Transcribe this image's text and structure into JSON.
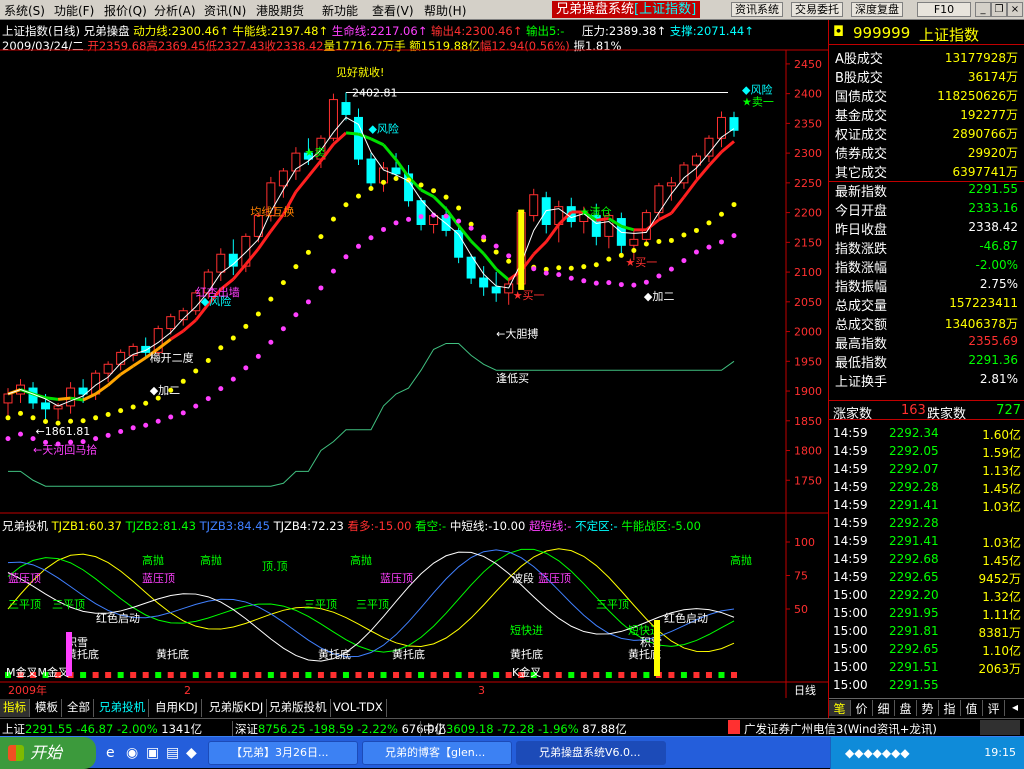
{
  "menu": {
    "items": [
      "系统(S)",
      "功能(F)",
      "报价(Q)",
      "分析(A)",
      "资讯(N)",
      "港股期货",
      "新功能",
      "查看(V)",
      "帮助(H)"
    ],
    "title": "兄弟操盘系统",
    "title_sub": "[上证指数]",
    "buttons": [
      "资讯系统",
      "交易委托",
      "深度复盘"
    ],
    "fkey": "F10"
  },
  "chart_header": {
    "line1": {
      "name": "上证指数(日线)",
      "tool": "兄弟操盘",
      "dl": "动力线:2300.46↑",
      "nn": "牛能线:2197.48↑",
      "sm": "生命线:2217.06↑",
      "sc": "输出4:2300.46↑",
      "sc5": "输出5:-",
      "yl": "压力:2389.38↑",
      "zc": "支撑:2071.44↑"
    },
    "line2": {
      "date": "2009/03/24/二",
      "open": "开2359.68",
      "high": "高2369.45",
      "low": "低2327.43",
      "close": "收2338.42",
      "vol": "量17716.7万手",
      "amt": "额1519.88亿",
      "chg": "幅12.94(0.56%)",
      "amp": "振1.81%"
    }
  },
  "chart_data": [
    {
      "type": "candlestick",
      "title": "上证指数(日线)",
      "ylim": [
        1700,
        2470
      ],
      "yticks": [
        2450,
        2400,
        2350,
        2300,
        2250,
        2200,
        2150,
        2100,
        2050,
        2000,
        1950,
        1900,
        1850,
        1800,
        1750
      ],
      "ohlc": [
        [
          1880,
          1905,
          1858,
          1895
        ],
        [
          1895,
          1920,
          1880,
          1910
        ],
        [
          1905,
          1915,
          1870,
          1880
        ],
        [
          1880,
          1895,
          1850,
          1870
        ],
        [
          1870,
          1880,
          1852,
          1875
        ],
        [
          1875,
          1915,
          1862,
          1905
        ],
        [
          1905,
          1920,
          1880,
          1895
        ],
        [
          1895,
          1935,
          1885,
          1930
        ],
        [
          1930,
          1950,
          1915,
          1945
        ],
        [
          1945,
          1970,
          1935,
          1965
        ],
        [
          1960,
          1980,
          1950,
          1975
        ],
        [
          1975,
          1990,
          1955,
          1965
        ],
        [
          1965,
          2010,
          1960,
          2005
        ],
        [
          2005,
          2030,
          1995,
          2025
        ],
        [
          2020,
          2040,
          2010,
          2035
        ],
        [
          2035,
          2070,
          2028,
          2065
        ],
        [
          2065,
          2105,
          2055,
          2100
        ],
        [
          2100,
          2140,
          2085,
          2130
        ],
        [
          2130,
          2155,
          2095,
          2110
        ],
        [
          2110,
          2165,
          2100,
          2160
        ],
        [
          2160,
          2200,
          2150,
          2195
        ],
        [
          2195,
          2260,
          2185,
          2250
        ],
        [
          2245,
          2275,
          2225,
          2270
        ],
        [
          2270,
          2310,
          2255,
          2300
        ],
        [
          2300,
          2325,
          2280,
          2290
        ],
        [
          2290,
          2330,
          2275,
          2325
        ],
        [
          2325,
          2400,
          2320,
          2390
        ],
        [
          2385,
          2402,
          2355,
          2365
        ],
        [
          2360,
          2375,
          2280,
          2290
        ],
        [
          2290,
          2300,
          2240,
          2250
        ],
        [
          2250,
          2285,
          2235,
          2275
        ],
        [
          2275,
          2300,
          2255,
          2265
        ],
        [
          2265,
          2280,
          2210,
          2220
        ],
        [
          2220,
          2225,
          2170,
          2180
        ],
        [
          2180,
          2200,
          2165,
          2195
        ],
        [
          2195,
          2210,
          2160,
          2170
        ],
        [
          2170,
          2175,
          2115,
          2125
        ],
        [
          2125,
          2130,
          2080,
          2090
        ],
        [
          2090,
          2110,
          2060,
          2075
        ],
        [
          2075,
          2100,
          2050,
          2065
        ],
        [
          2065,
          2090,
          2045,
          2080
        ],
        [
          2080,
          2200,
          2075,
          2200
        ],
        [
          2195,
          2240,
          2185,
          2230
        ],
        [
          2225,
          2235,
          2165,
          2180
        ],
        [
          2180,
          2220,
          2150,
          2210
        ],
        [
          2210,
          2225,
          2175,
          2185
        ],
        [
          2185,
          2210,
          2165,
          2200
        ],
        [
          2195,
          2215,
          2145,
          2160
        ],
        [
          2160,
          2200,
          2140,
          2195
        ],
        [
          2190,
          2200,
          2130,
          2145
        ],
        [
          2145,
          2170,
          2120,
          2155
        ],
        [
          2155,
          2205,
          2150,
          2200
        ],
        [
          2200,
          2250,
          2190,
          2245
        ],
        [
          2245,
          2260,
          2220,
          2250
        ],
        [
          2250,
          2285,
          2240,
          2280
        ],
        [
          2280,
          2300,
          2255,
          2295
        ],
        [
          2295,
          2330,
          2285,
          2325
        ],
        [
          2325,
          2370,
          2310,
          2360
        ],
        [
          2359.68,
          2369.45,
          2327.43,
          2338.42
        ]
      ],
      "annotations": {
        "high_label": "2402.81",
        "low_label": "1861.81",
        "texts": [
          "见好就收!",
          "风险",
          "风险",
          "风险",
          "卖一",
          "卖",
          "清仓",
          "买一",
          "买一",
          "加二",
          "加二",
          "均线互换",
          "红杏出墙",
          "梅开二度",
          "天河回马拾",
          "大胆搏",
          "逢低买"
        ]
      }
    },
    {
      "type": "line",
      "title": "兄弟投机",
      "series": [
        {
          "name": "TJZB1:60.37",
          "color": "#ffff00"
        },
        {
          "name": "TJZB2:81.43",
          "color": "#00ff00"
        },
        {
          "name": "TJZB3:84.45",
          "color": "#4080ff"
        },
        {
          "name": "TJZB4:72.23",
          "color": "#ffffff"
        }
      ],
      "yticks": [
        100.0,
        75.0,
        50.0
      ],
      "header_extra": [
        "看多:-15.00",
        "看空:-",
        "中短线:-10.00",
        "超短线:-",
        "不定区:-",
        "牛能战区:-5.00"
      ],
      "annotations": [
        "蓝压顶",
        "蓝压顶",
        "蓝压顶",
        "蓝压顶",
        "高抛",
        "高抛",
        "高抛",
        "高抛",
        "顶.顶",
        "三平顶",
        "三平顶",
        "三平顶",
        "三平顶",
        "三平顶",
        "波段",
        "短快进",
        "短快进",
        "红色启动",
        "红色启动",
        "积雪",
        "积雪",
        "黄托底",
        "黄托底",
        "黄托底",
        "黄托底",
        "黄托底",
        "黄托底",
        "M金叉M金叉",
        "K金叉"
      ]
    }
  ],
  "axis_bottom": {
    "year": "2009年",
    "m2": "2",
    "m3": "3",
    "period": "日线"
  },
  "bottom_tabs": [
    "指标",
    "模板",
    "全部",
    "兄弟投机",
    "自用KDJ",
    "兄弟版KDJ",
    "兄弟版投机",
    "VOL-TDX"
  ],
  "right_panel": {
    "code": "999999",
    "name": "上证指数",
    "rows": [
      {
        "label": "A股成交",
        "value": "13177928万",
        "color": "#ffff00"
      },
      {
        "label": "B股成交",
        "value": "36174万",
        "color": "#ffff00"
      },
      {
        "label": "国债成交",
        "value": "118250626万",
        "color": "#ffff00"
      },
      {
        "label": "基金成交",
        "value": "192277万",
        "color": "#ffff00"
      },
      {
        "label": "权证成交",
        "value": "2890766万",
        "color": "#ffff00"
      },
      {
        "label": "债券成交",
        "value": "29920万",
        "color": "#ffff00"
      },
      {
        "label": "其它成交",
        "value": "6397741万",
        "color": "#ffff00"
      },
      {
        "label": "最新指数",
        "value": "2291.55",
        "color": "#00ff00"
      },
      {
        "label": "今日开盘",
        "value": "2333.16",
        "color": "#00ff00"
      },
      {
        "label": "昨日收盘",
        "value": "2338.42",
        "color": "#ffffff"
      },
      {
        "label": "指数涨跌",
        "value": "-46.87",
        "color": "#00ff00"
      },
      {
        "label": "指数涨幅",
        "value": "-2.00%",
        "color": "#00ff00"
      },
      {
        "label": "指数振幅",
        "value": "2.75%",
        "color": "#ffffff"
      },
      {
        "label": "总成交量",
        "value": "157223411",
        "color": "#ffff00"
      },
      {
        "label": "总成交额",
        "value": "13406378万",
        "color": "#ffff00"
      },
      {
        "label": "最高指数",
        "value": "2355.69",
        "color": "#ff3030"
      },
      {
        "label": "最低指数",
        "value": "2291.36",
        "color": "#00ff00"
      },
      {
        "label": "上证换手",
        "value": "2.81%",
        "color": "#ffffff"
      }
    ],
    "updown": {
      "up_label": "涨家数",
      "up": "163",
      "down_label": "跌家数",
      "down": "727"
    },
    "ticks": [
      {
        "t": "14:59",
        "p": "2292.34",
        "v": "1.60亿"
      },
      {
        "t": "14:59",
        "p": "2292.05",
        "v": "1.59亿"
      },
      {
        "t": "14:59",
        "p": "2292.07",
        "v": "1.13亿"
      },
      {
        "t": "14:59",
        "p": "2292.28",
        "v": "1.45亿"
      },
      {
        "t": "14:59",
        "p": "2291.41",
        "v": "1.03亿"
      },
      {
        "t": "14:59",
        "p": "2292.28",
        "v": ""
      },
      {
        "t": "14:59",
        "p": "2291.41",
        "v": "1.03亿"
      },
      {
        "t": "14:59",
        "p": "2292.68",
        "v": "1.45亿"
      },
      {
        "t": "14:59",
        "p": "2292.65",
        "v": "9452万"
      },
      {
        "t": "15:00",
        "p": "2292.20",
        "v": "1.32亿"
      },
      {
        "t": "15:00",
        "p": "2291.95",
        "v": "1.11亿"
      },
      {
        "t": "15:00",
        "p": "2291.81",
        "v": "8381万"
      },
      {
        "t": "15:00",
        "p": "2292.65",
        "v": "1.10亿"
      },
      {
        "t": "15:00",
        "p": "2291.51",
        "v": "2063万"
      },
      {
        "t": "15:00",
        "p": "2291.55",
        "v": ""
      }
    ],
    "tabs": [
      "笔",
      "价",
      "细",
      "盘",
      "势",
      "指",
      "值",
      "评"
    ]
  },
  "status_bar": {
    "sh_label": "上证",
    "sh_val": "2291.55",
    "sh_chg": "-46.87",
    "sh_pct": "-2.00%",
    "sh_amt": "1341亿",
    "sz_label": "深证",
    "sz_val": "8756.25",
    "sz_chg": "-198.59",
    "sz_pct": "-2.22%",
    "sz_amt": "676.0亿",
    "zx_label": "中小",
    "zx_val": "3609.18",
    "zx_chg": "-72.28",
    "zx_pct": "-1.96%",
    "zx_amt": "87.88亿",
    "broker": "广发证券广州电信3(Wind资讯+龙讯)"
  },
  "taskbar": {
    "start": "开始",
    "tasks": [
      "【兄弟】3月26日...",
      "兄弟的博客【glen...",
      "兄弟操盘系统V6.0..."
    ],
    "clock": "19:15"
  }
}
